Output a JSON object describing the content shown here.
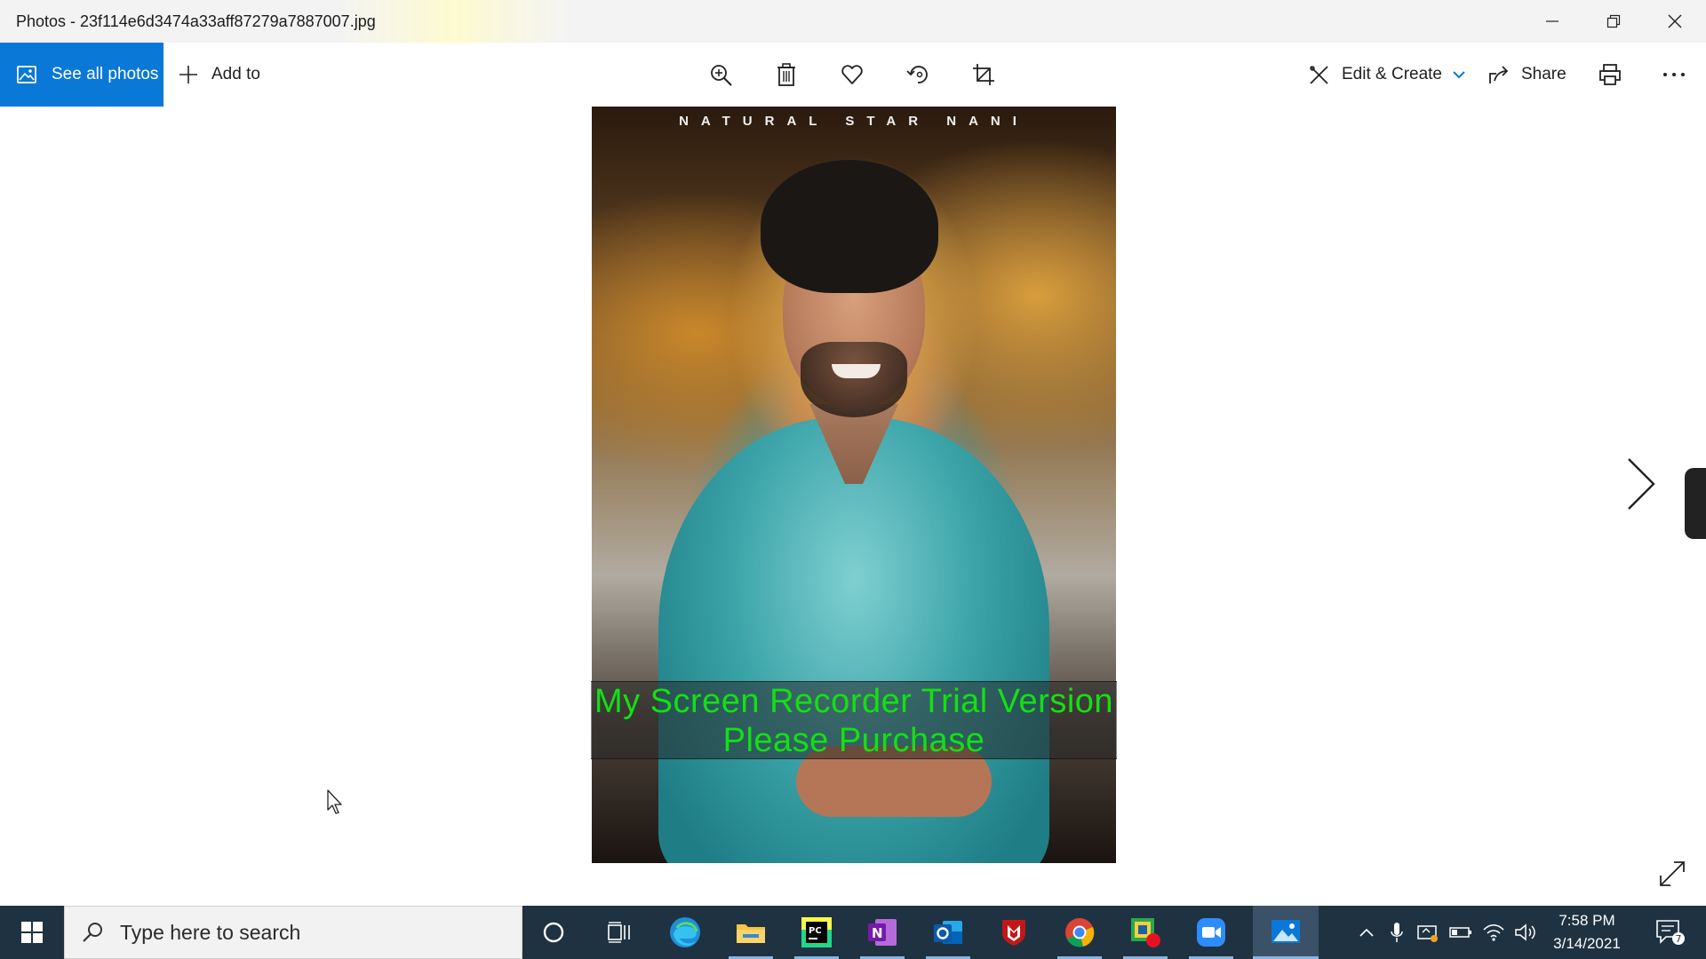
{
  "window": {
    "title": "Photos - 23f114e6d3474a33aff87279a7887007.jpg"
  },
  "toolbar": {
    "see_all_photos": "See all photos",
    "add_to": "Add to",
    "icons": [
      "zoom-icon",
      "delete-icon",
      "favorite-icon",
      "rotate-icon",
      "crop-icon"
    ],
    "edit_create": "Edit & Create",
    "share": "Share"
  },
  "photo": {
    "caption": "NATURAL STAR NANI"
  },
  "watermark": {
    "line1": "My Screen Recorder Trial Version",
    "line2": "Please Purchase"
  },
  "taskbar": {
    "search_placeholder": "Type here to search",
    "apps": [
      "cortana",
      "task-view",
      "edge",
      "file-explorer",
      "pycharm",
      "onenote",
      "outlook",
      "mcafee",
      "chrome",
      "screen-recorder",
      "zoom",
      "photos"
    ],
    "active_app": "photos",
    "time": "7:58 PM",
    "date": "3/14/2021",
    "notification_count": "7"
  },
  "colors": {
    "accent": "#0a78d7",
    "taskbar": "#1f3242",
    "watermark_text": "#13e013"
  }
}
